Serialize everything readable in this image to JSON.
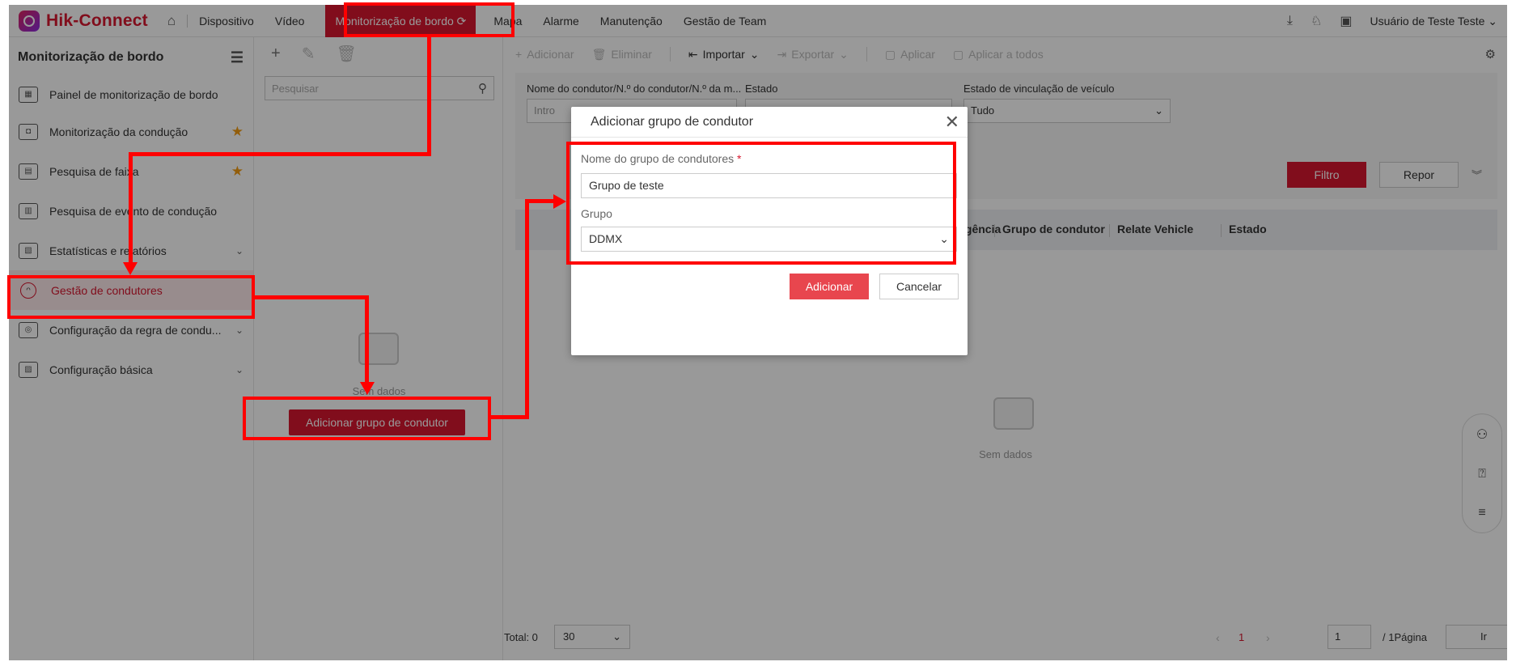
{
  "app": {
    "name": "Hik-Connect"
  },
  "topnav": {
    "items": [
      "Dispositivo",
      "Vídeo",
      "Monitorização de bordo",
      "Mapa",
      "Alarme",
      "Manutenção",
      "Gestão de Team"
    ],
    "active": "Monitorização de bordo",
    "user": "Usuário de Teste Teste"
  },
  "sidebar": {
    "title": "Monitorização de bordo",
    "items": [
      {
        "label": "Painel de monitorização de bordo",
        "icon": "dashboard-icon"
      },
      {
        "label": "Monitorização da condução",
        "icon": "vehicle-monitor-icon",
        "starred": true
      },
      {
        "label": "Pesquisa de faixa",
        "icon": "track-search-icon",
        "starred": true
      },
      {
        "label": "Pesquisa de evento de condução",
        "icon": "event-search-icon"
      },
      {
        "label": "Estatísticas e relatórios",
        "icon": "statistics-icon",
        "expandable": true
      },
      {
        "label": "Gestão de condutores",
        "icon": "driver-icon",
        "active": true
      },
      {
        "label": "Configuração da regra de condu...",
        "icon": "steering-wheel-icon",
        "expandable": true
      },
      {
        "label": "Configuração básica",
        "icon": "basic-config-icon",
        "expandable": true
      }
    ]
  },
  "group_panel": {
    "search_placeholder": "Pesquisar",
    "empty_text": "Sem dados",
    "add_button": "Adicionar grupo de condutor"
  },
  "toolbar": {
    "add": "Adicionar",
    "delete": "Eliminar",
    "import": "Importar",
    "export": "Exportar",
    "apply": "Aplicar",
    "apply_all": "Aplicar a todos"
  },
  "filter": {
    "driver_label": "Nome do condutor/N.º do condutor/N.º da m...",
    "driver_placeholder": "Intro",
    "status_label": "Estado",
    "binding_label": "Estado de vinculação de veículo",
    "binding_value": "Tudo",
    "filter_button": "Filtro",
    "reset_button": "Repor"
  },
  "table": {
    "columns": [
      "Período de vigência",
      "Grupo de condutor",
      "Relate Vehicle",
      "Estado"
    ],
    "empty_text": "Sem dados"
  },
  "pagination": {
    "total": "Total: 0",
    "page_size": "30",
    "current_page": "1",
    "page_input": "1",
    "total_pages": "/ 1Página",
    "go_button": "Ir"
  },
  "modal": {
    "title": "Adicionar grupo de condutor",
    "name_label": "Nome do grupo de condutores",
    "required_mark": "*",
    "name_value": "Grupo de teste",
    "group_label": "Grupo",
    "group_value": "DDMX",
    "add_button": "Adicionar",
    "cancel_button": "Cancelar"
  },
  "colors": {
    "accent": "#d7172f",
    "annotation": "#ff0000"
  }
}
